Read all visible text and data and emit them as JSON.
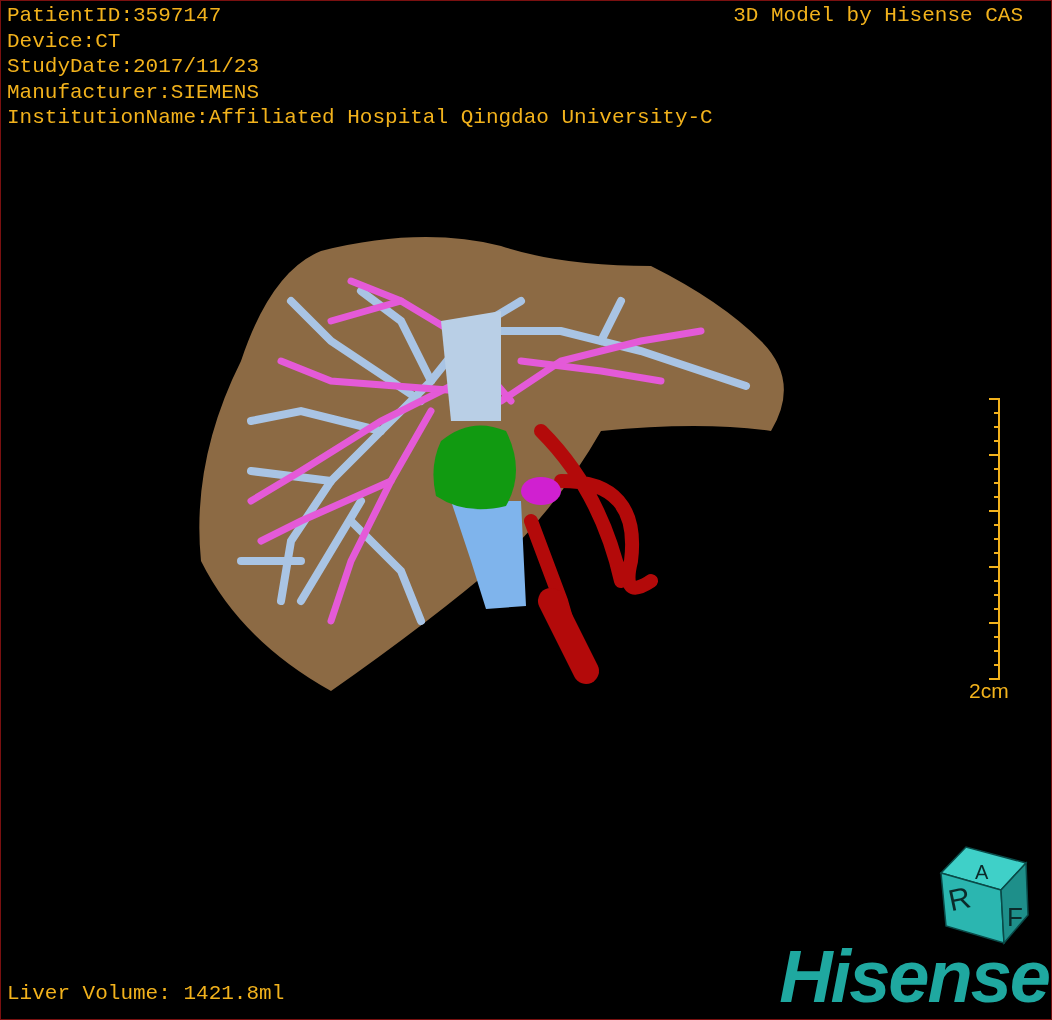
{
  "patient_info": [
    "PatientID:3597147",
    "Device:CT",
    "StudyDate:2017/11/23",
    "Manufacturer:SIEMENS",
    "InstitutionName:Affiliated Hospital Qingdao University-C"
  ],
  "model_credit": "3D Model by Hisense CAS",
  "scale_bar": {
    "label": "2cm"
  },
  "orientation_cube": {
    "faces": [
      "R",
      "A",
      "F"
    ]
  },
  "liver_volume": "Liver Volume: 1421.8ml",
  "logo": "Hisense"
}
